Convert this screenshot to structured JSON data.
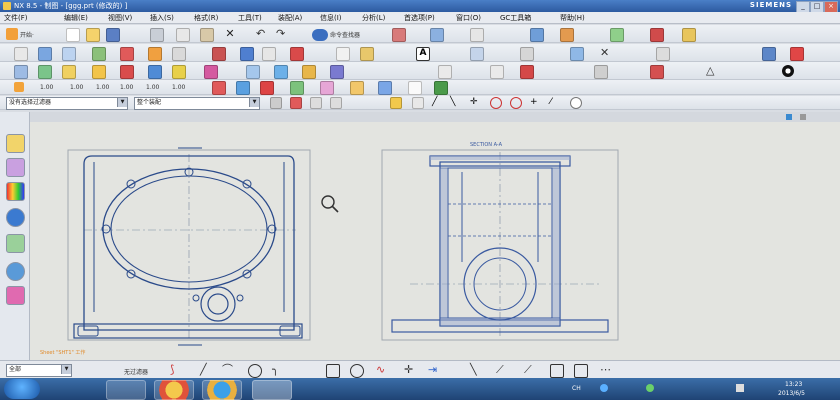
{
  "window": {
    "title": "NX 8.5 - 制图 - [ggg.prt (修改的) ]",
    "brand": "SIEMENS",
    "controls": [
      "_",
      "□",
      "×"
    ]
  },
  "menu": {
    "items": [
      "文件(F)",
      "编辑(E)",
      "视图(V)",
      "插入(S)",
      "格式(R)",
      "工具(T)",
      "装配(A)",
      "信息(I)",
      "分析(L)",
      "首选项(P)",
      "窗口(O)",
      "GC工具箱",
      "帮助(H)"
    ]
  },
  "toolbar1": {
    "start_label": "开始·",
    "command_finder": "命令查找器"
  },
  "toolbar3": {
    "dim_labels": [
      "1.00",
      "1.00",
      "1.00",
      "1.00",
      "1.00",
      "1.00"
    ]
  },
  "filter_row": {
    "type_filter": "没有选择过滤器",
    "scope": "整个装配"
  },
  "drawing": {
    "section_label": "SECTION A-A",
    "prompt": "Sheet \"SHT1\" 工作",
    "colors": {
      "line": "#2a4a8a",
      "frame": "#a0a8b0",
      "centerline": "#7a8aa0",
      "section": "#3a5aa0"
    }
  },
  "bottom_bar": {
    "select_value": "全部",
    "snap_label": "无过滤器"
  },
  "taskbar": {
    "clock_time": "13:23",
    "clock_date": "2013/6/5",
    "lang": "CH"
  }
}
